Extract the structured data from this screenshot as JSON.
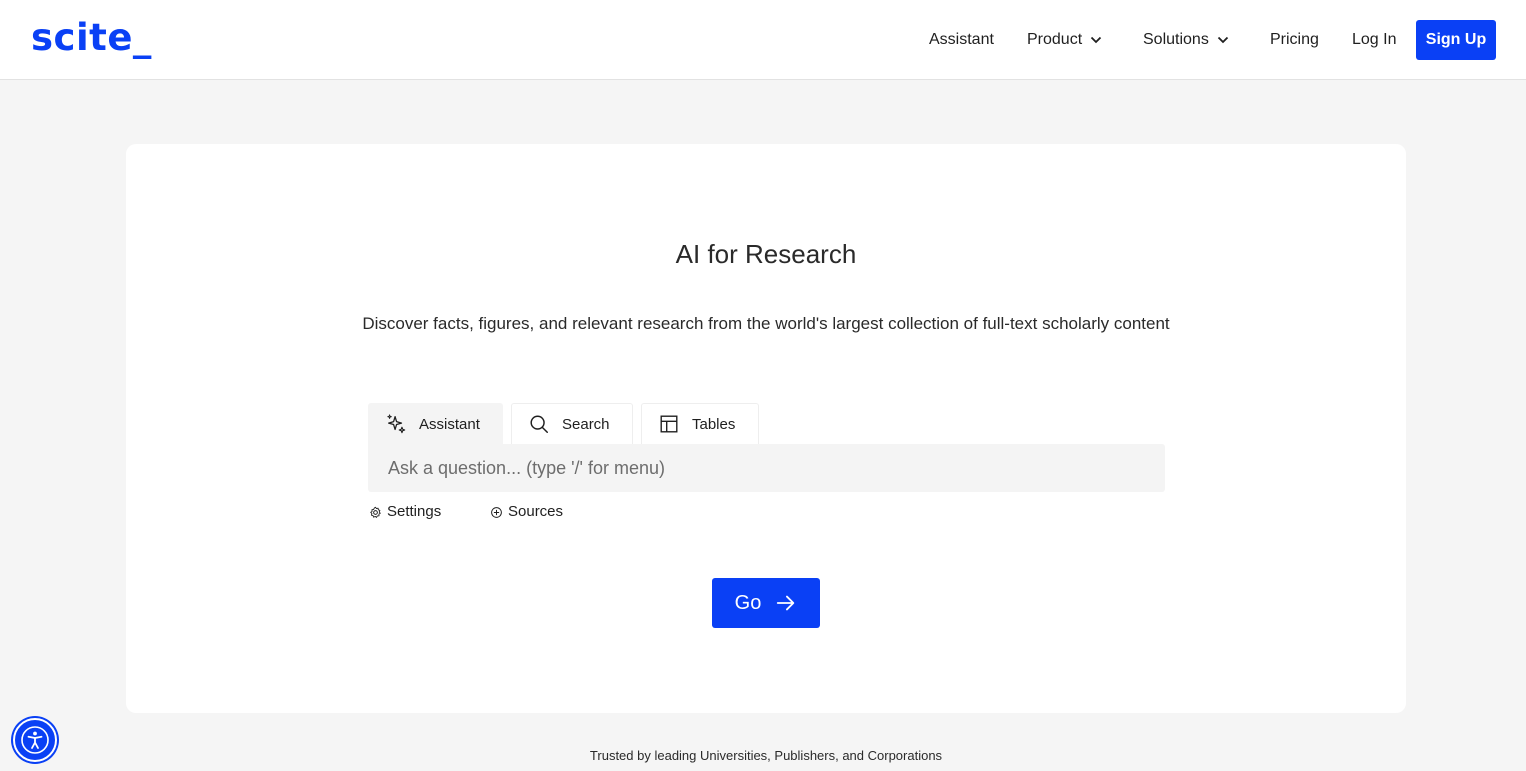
{
  "header": {
    "logo": "scite_",
    "nav": {
      "assistant": "Assistant",
      "product": "Product",
      "solutions": "Solutions",
      "pricing": "Pricing",
      "login": "Log In"
    },
    "signup": "Sign Up"
  },
  "hero": {
    "title": "AI for Research",
    "subtitle": "Discover facts, figures, and relevant research from the world's largest collection of full-text scholarly content"
  },
  "search": {
    "tabs": [
      {
        "label": "Assistant",
        "icon": "sparkles-icon",
        "active": true
      },
      {
        "label": "Search",
        "icon": "search-icon",
        "active": false
      },
      {
        "label": "Tables",
        "icon": "table-icon",
        "active": false
      }
    ],
    "placeholder": "Ask a question... (type '/' for menu)",
    "value": "",
    "settings": "Settings",
    "sources": "Sources",
    "go": "Go"
  },
  "footer": {
    "trusted": "Trusted by leading Universities, Publishers, and Corporations"
  },
  "colors": {
    "brand": "#0a40f5",
    "background": "#f5f5f5",
    "card": "#ffffff"
  }
}
